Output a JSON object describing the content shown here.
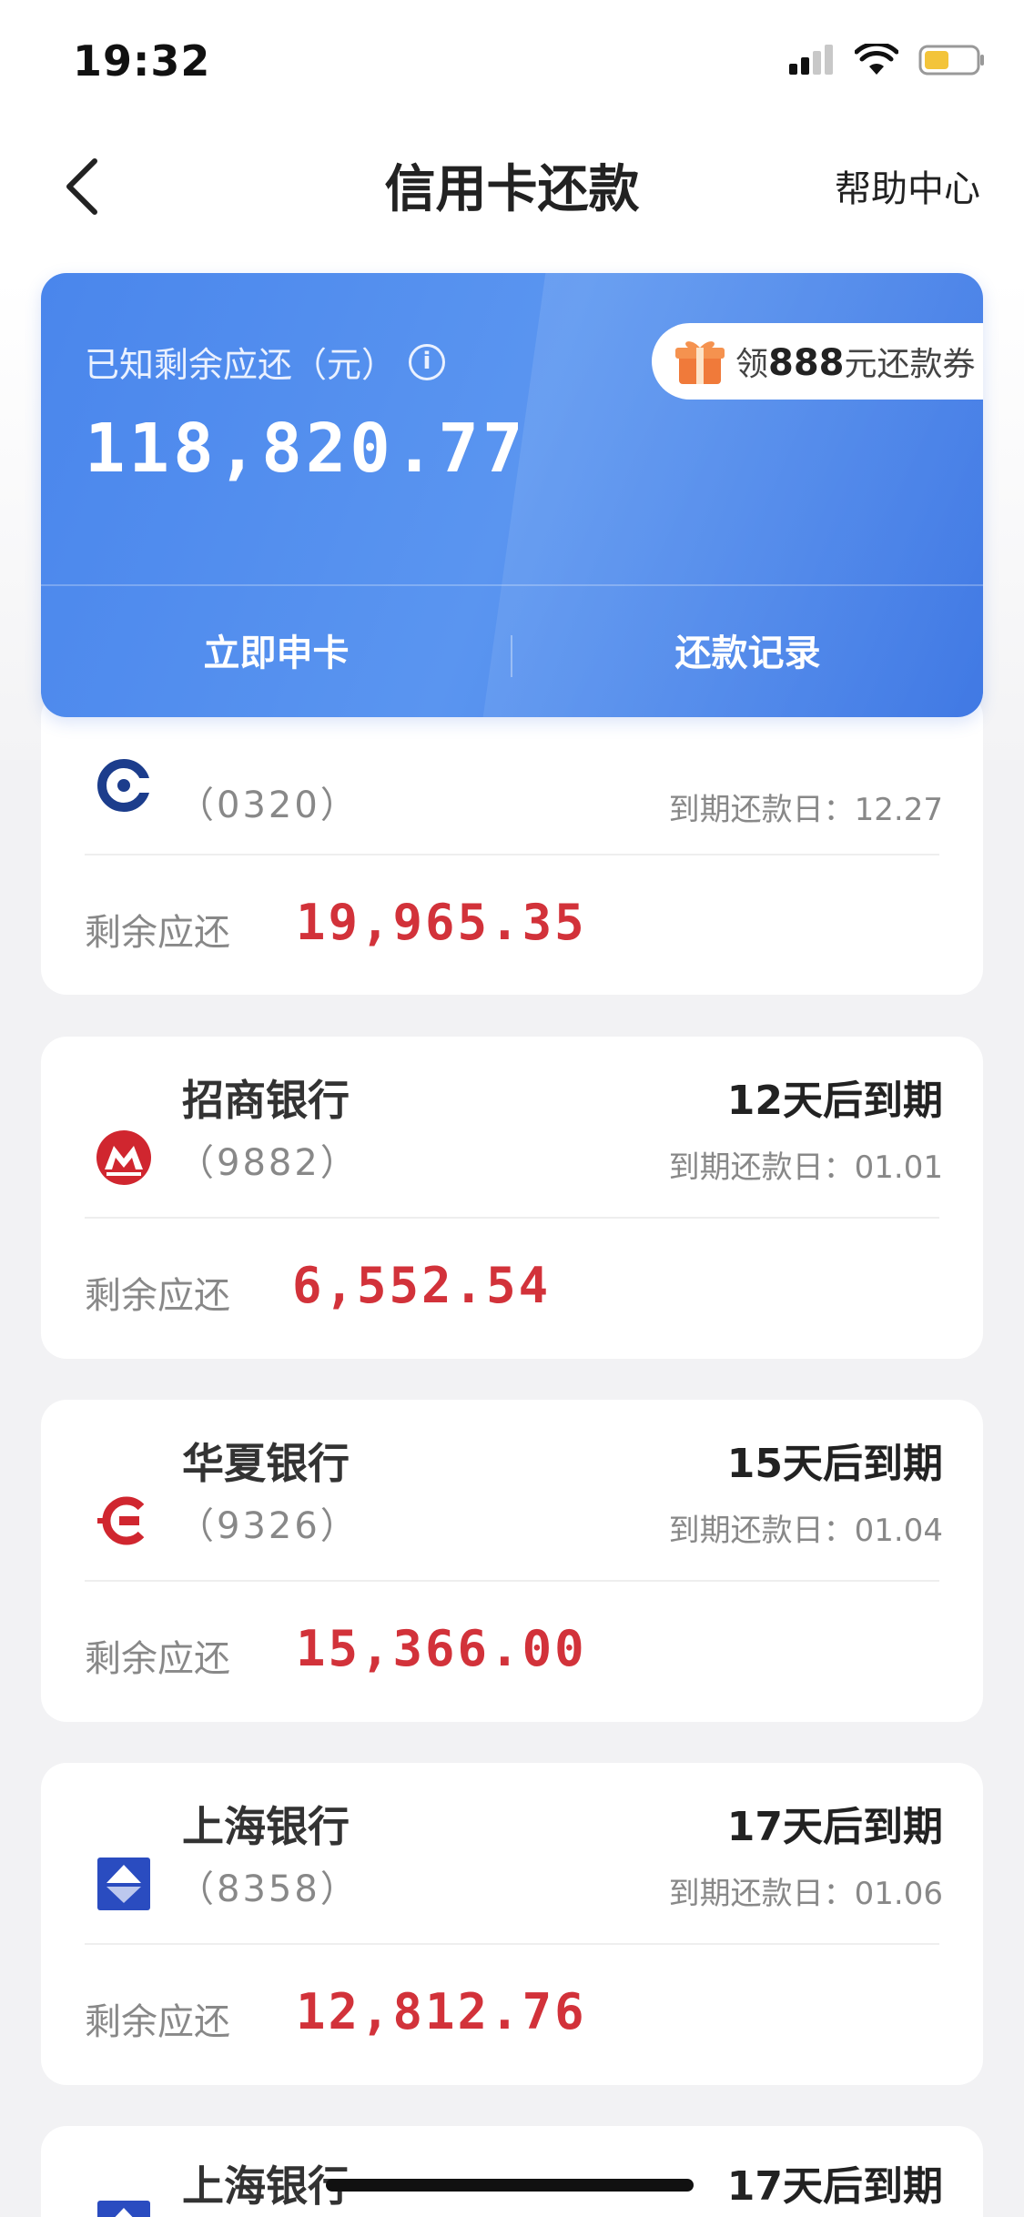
{
  "status_bar": {
    "time": "19:32"
  },
  "nav": {
    "title": "信用卡还款",
    "help": "帮助中心"
  },
  "summary": {
    "label": "已知剩余应还（元）",
    "amount": "118,820.77",
    "coupon_prefix": "领",
    "coupon_amount": "888",
    "coupon_suffix": "元还款券",
    "apply_label": "立即申卡",
    "records_label": "还款记录"
  },
  "cards": [
    {
      "bank_name": "",
      "card_no": "（0320）",
      "due_title": "",
      "due_date": "到期还款日：12.27",
      "remain_label": "剩余应还",
      "remain_amount": "19,965.35",
      "logo_color": "#1c3d8c"
    },
    {
      "bank_name": "招商银行",
      "card_no": "（9882）",
      "due_title": "12天后到期",
      "due_date": "到期还款日：01.01",
      "remain_label": "剩余应还",
      "remain_amount": "6,552.54",
      "logo_color": "#d0262f"
    },
    {
      "bank_name": "华夏银行",
      "card_no": "（9326）",
      "due_title": "15天后到期",
      "due_date": "到期还款日：01.04",
      "remain_label": "剩余应还",
      "remain_amount": "15,366.00",
      "logo_color": "#d0262f"
    },
    {
      "bank_name": "上海银行",
      "card_no": "（8358）",
      "due_title": "17天后到期",
      "due_date": "到期还款日：01.06",
      "remain_label": "剩余应还",
      "remain_amount": "12,812.76",
      "logo_color": "#2a4cc0"
    },
    {
      "bank_name": "上海银行",
      "card_no": "",
      "due_title": "17天后到期",
      "due_date": "",
      "remain_label": "",
      "remain_amount": "",
      "logo_color": "#2a4cc0"
    }
  ],
  "colors": {
    "brand_blue": "#4a86ec",
    "amount_red": "#d2323a"
  }
}
